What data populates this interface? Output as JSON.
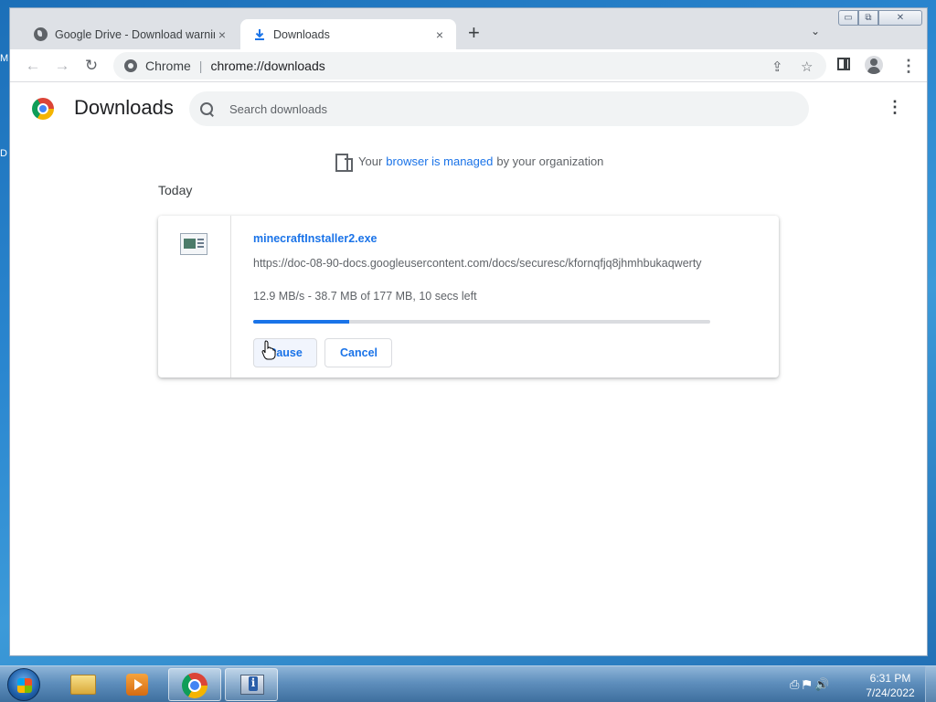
{
  "desktop": {
    "edge_text_1": "M",
    "edge_text_2": "D"
  },
  "window": {
    "tabs": [
      {
        "title": "Google Drive - Download warning",
        "close": "×",
        "active": false
      },
      {
        "title": "Downloads",
        "close": "×",
        "active": true
      }
    ],
    "new_tab": "+",
    "tab_search": "⌄",
    "caption_min": "▭",
    "caption_max": "⧉",
    "caption_close": "✕"
  },
  "toolbar": {
    "back": "←",
    "forward": "→",
    "reload": "↻",
    "omnibox_scheme": "Chrome",
    "omnibox_separator": "|",
    "omnibox_url": "chrome://downloads",
    "share_icon": "⇪",
    "bookmark_icon": "☆",
    "menu": "⋮"
  },
  "page": {
    "title": "Downloads",
    "search_placeholder": "Search downloads",
    "menu": "⋮",
    "managed": {
      "prefix": "Your",
      "link": "browser is managed",
      "suffix": "by your organization"
    },
    "section_label": "Today",
    "download": {
      "file_name": "minecraftInstaller2.exe",
      "url": "https://doc-08-90-docs.googleusercontent.com/docs/securesc/kfornqfjq8jhmhbukaqwerty",
      "status": "12.9 MB/s - 38.7 MB of 177 MB, 10 secs left",
      "progress_fraction": 0.21,
      "pause_label": "Pause",
      "cancel_label": "Cancel"
    }
  },
  "taskbar": {
    "clock_time": "6:31 PM",
    "clock_date": "7/24/2022",
    "tray_icons": "⎙ ⚑ 🔊"
  },
  "colors": {
    "accent": "#1a73e8",
    "progress_track": "#dadce0"
  }
}
